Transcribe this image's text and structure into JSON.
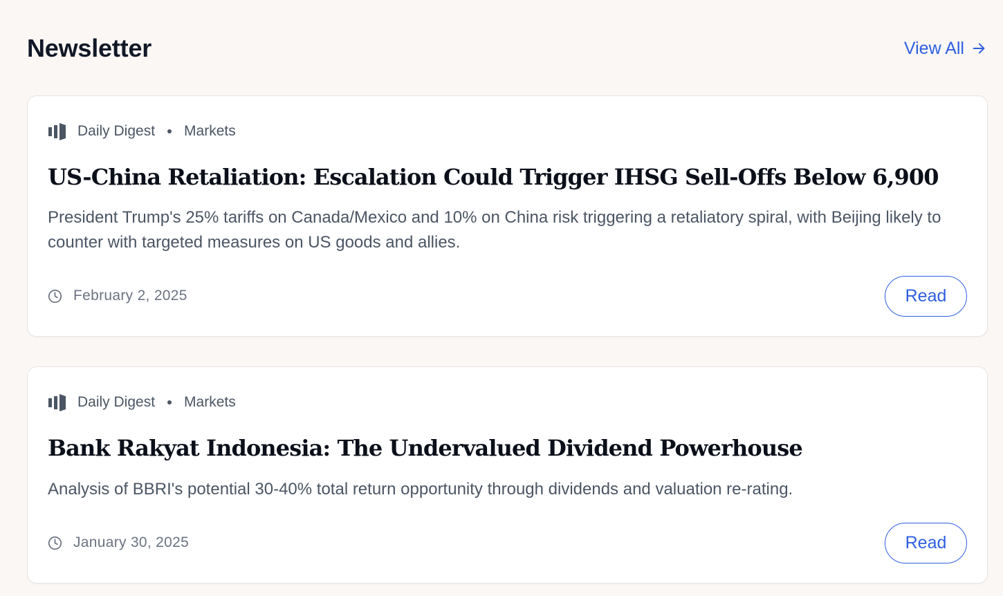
{
  "header": {
    "title": "Newsletter",
    "view_all_label": "View All",
    "view_all_icon": "arrow-right-icon"
  },
  "colors": {
    "accent": "#2f5fe0",
    "background": "#faf7f4",
    "card": "#ffffff",
    "muted_text": "#4b5563"
  },
  "articles": [
    {
      "publication": "Daily Digest",
      "category": "Markets",
      "title": "US-China Retaliation: Escalation Could Trigger IHSG Sell-Offs Below 6,900",
      "summary": "President Trump's 25% tariffs on Canada/Mexico and 10% on China risk triggering a retaliatory spiral, with Beijing likely to counter with targeted measures on US goods and allies.",
      "date": "February 2, 2025",
      "read_label": "Read"
    },
    {
      "publication": "Daily Digest",
      "category": "Markets",
      "title": "Bank Rakyat Indonesia: The Undervalued Dividend Powerhouse",
      "summary": "Analysis of BBRI's potential 30-40% total return opportunity through dividends and valuation re-rating.",
      "date": "January 30, 2025",
      "read_label": "Read"
    }
  ]
}
